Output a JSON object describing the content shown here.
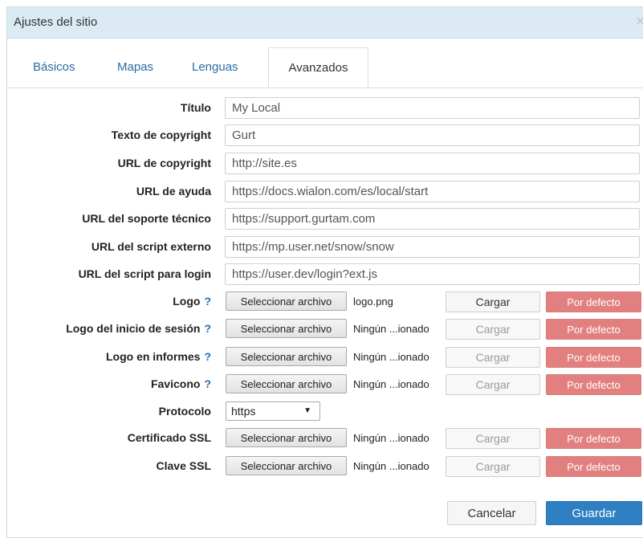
{
  "dialog": {
    "title": "Ajustes del sitio",
    "close_symbol": "×"
  },
  "tabs": [
    {
      "label": "Básicos",
      "active": false
    },
    {
      "label": "Mapas",
      "active": false
    },
    {
      "label": "Lenguas",
      "active": false
    },
    {
      "label": "Avanzados",
      "active": true
    }
  ],
  "fields": {
    "titulo": {
      "label": "Título",
      "value": "My Local"
    },
    "copyright_text": {
      "label": "Texto de copyright",
      "value": "Gurt"
    },
    "copyright_url": {
      "label": "URL de copyright",
      "value": "http://site.es"
    },
    "help_url": {
      "label": "URL de ayuda",
      "value": "https://docs.wialon.com/es/local/start"
    },
    "support_url": {
      "label": "URL del soporte técnico",
      "value": "https://support.gurtam.com"
    },
    "external_script_url": {
      "label": "URL del script externo",
      "value": "https://mp.user.net/snow/snow"
    },
    "login_script_url": {
      "label": "URL del script para login",
      "value": "https://user.dev/login?ext.js"
    }
  },
  "files": {
    "select_label": "Seleccionar archivo",
    "upload_label": "Cargar",
    "default_label": "Por defecto",
    "help_mark": "?",
    "logo": {
      "label": "Logo",
      "filename": "logo.png",
      "upload_enabled": true
    },
    "login_logo": {
      "label": "Logo del inicio de sesión",
      "filename": "Ningún ...ionado",
      "upload_enabled": false
    },
    "report_logo": {
      "label": "Logo en informes",
      "filename": "Ningún ...ionado",
      "upload_enabled": false
    },
    "favicon": {
      "label": "Favicono",
      "filename": "Ningún ...ionado",
      "upload_enabled": false
    },
    "ssl_cert": {
      "label": "Certificado SSL",
      "filename": "Ningún ...ionado",
      "upload_enabled": false
    },
    "ssl_key": {
      "label": "Clave SSL",
      "filename": "Ningún ...ionado",
      "upload_enabled": false
    }
  },
  "protocol": {
    "label": "Protocolo",
    "value": "https",
    "arrow": "▼"
  },
  "footer": {
    "cancel_label": "Cancelar",
    "save_label": "Guardar"
  },
  "colors": {
    "titlebar": "#dcebf3",
    "tab_link": "#2a6ca3",
    "default_button": "#e1807f",
    "save_button": "#2f80c2"
  }
}
